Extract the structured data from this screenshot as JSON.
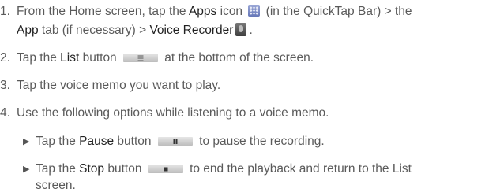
{
  "steps": [
    {
      "num": "1.",
      "l1_a": "From the Home screen, tap the ",
      "l1_apps": "Apps",
      "l1_b": " icon ",
      "l1_c": " (in the QuickTap Bar) > the",
      "l2_app": "App",
      "l2_a": " tab (if necessary) > ",
      "l2_recorder": "Voice Recorder",
      "l2_b": "."
    },
    {
      "num": "2.",
      "a": "Tap the ",
      "bold": "List",
      "b": " button ",
      "c": " at the bottom of the screen."
    },
    {
      "num": "3.",
      "text": "Tap the voice memo you want to play."
    },
    {
      "num": "4.",
      "text": "Use the following options while listening to a voice memo."
    }
  ],
  "bullets": [
    {
      "a": "Tap the ",
      "bold": "Pause",
      "b": " button ",
      "c": " to pause the recording."
    },
    {
      "a": "Tap the ",
      "bold": "Stop",
      "b": " button ",
      "c": " to end the playback and return to the List",
      "cont": "screen."
    }
  ],
  "icons": {
    "apps": "apps-grid-icon",
    "recorder": "voice-recorder-icon",
    "list": "list-button-icon",
    "pause": "pause-button-icon",
    "stop": "stop-button-icon"
  }
}
